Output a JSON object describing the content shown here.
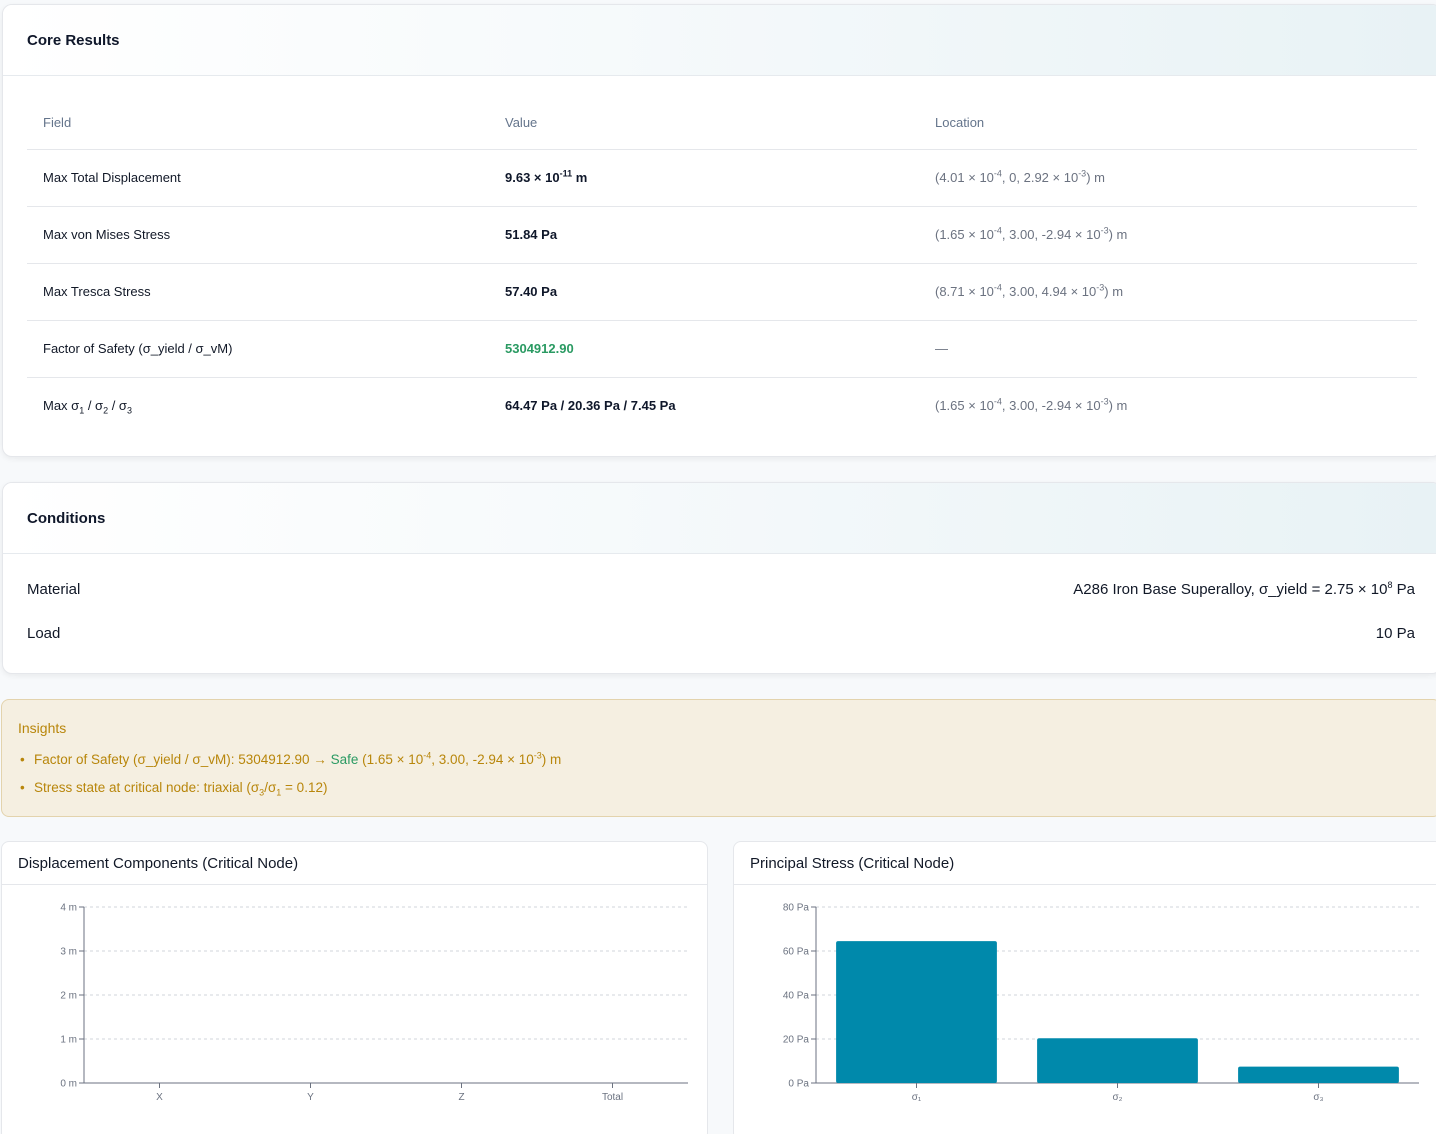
{
  "core_results": {
    "title": "Core Results",
    "headers": [
      "Field",
      "Value",
      "Location"
    ],
    "rows": [
      {
        "field": "Max Total Displacement",
        "value_mantissa": "9.63 × 10",
        "value_exp": "-11",
        "value_unit": " m",
        "loc": {
          "a": "(4.01 × 10",
          "a_exp": "-4",
          "b": ", 0, 2.92 × 10",
          "b_exp": "-3",
          "c": ") m"
        }
      },
      {
        "field": "Max von Mises Stress",
        "value": "51.84 Pa",
        "loc": {
          "a": "(1.65 × 10",
          "a_exp": "-4",
          "b": ", 3.00, -2.94 × 10",
          "b_exp": "-3",
          "c": ") m"
        }
      },
      {
        "field": "Max Tresca Stress",
        "value": "57.40 Pa",
        "loc": {
          "a": "(8.71 × 10",
          "a_exp": "-4",
          "b": ", 3.00, 4.94 × 10",
          "b_exp": "-3",
          "c": ") m"
        }
      },
      {
        "field": "Factor of Safety (σ_yield / σ_vM)",
        "value": "5304912.90",
        "loc_text": "—"
      },
      {
        "field_a": "Max σ",
        "field_sub1": "1",
        "field_b": " / σ",
        "field_sub2": "2",
        "field_c": " / σ",
        "field_sub3": "3",
        "value": "64.47 Pa / 20.36 Pa / 7.45 Pa",
        "loc": {
          "a": "(1.65 × 10",
          "a_exp": "-4",
          "b": ", 3.00, -2.94 × 10",
          "b_exp": "-3",
          "c": ") m"
        }
      }
    ]
  },
  "conditions": {
    "title": "Conditions",
    "material_label": "Material",
    "material_value": "A286 Iron Base Superalloy, σ_yield = 2.75 × 10",
    "material_exp": "8",
    "material_unit": " Pa",
    "load_label": "Load",
    "load_value": "10 Pa"
  },
  "insights": {
    "title": "Insights",
    "item1_a": "Factor of Safety (σ_yield / σ_vM): 5304912.90 → ",
    "item1_safe": "Safe",
    "item1_b": " (1.65 × 10",
    "item1_exp1": "-4",
    "item1_c": ", 3.00, -2.94 × 10",
    "item1_exp2": "-3",
    "item1_d": ") m",
    "item2_a": "Stress state at critical node: triaxial (σ",
    "item2_sub1": "3",
    "item2_b": "/σ",
    "item2_sub2": "1",
    "item2_c": " = 0.12)"
  },
  "colors": {
    "accent_green": "#2a9a62",
    "insight_text": "#b8860b",
    "bar_fill": "#0089ab"
  },
  "chart_data": [
    {
      "type": "bar",
      "title": "Displacement Components (Critical Node)",
      "categories": [
        "X",
        "Y",
        "Z",
        "Total"
      ],
      "values": [
        0,
        0,
        0,
        0
      ],
      "ylim": [
        0,
        4
      ],
      "yticks": [
        "0 m",
        "1 m",
        "2 m",
        "3 m",
        "4 m"
      ],
      "grid": true
    },
    {
      "type": "bar",
      "title": "Principal Stress (Critical Node)",
      "categories": [
        "σ₁",
        "σ₂",
        "σ₃"
      ],
      "values": [
        64.47,
        20.36,
        7.45
      ],
      "ylim": [
        0,
        80
      ],
      "yticks": [
        "0 Pa",
        "20 Pa",
        "40 Pa",
        "60 Pa",
        "80 Pa"
      ],
      "grid": true
    }
  ]
}
